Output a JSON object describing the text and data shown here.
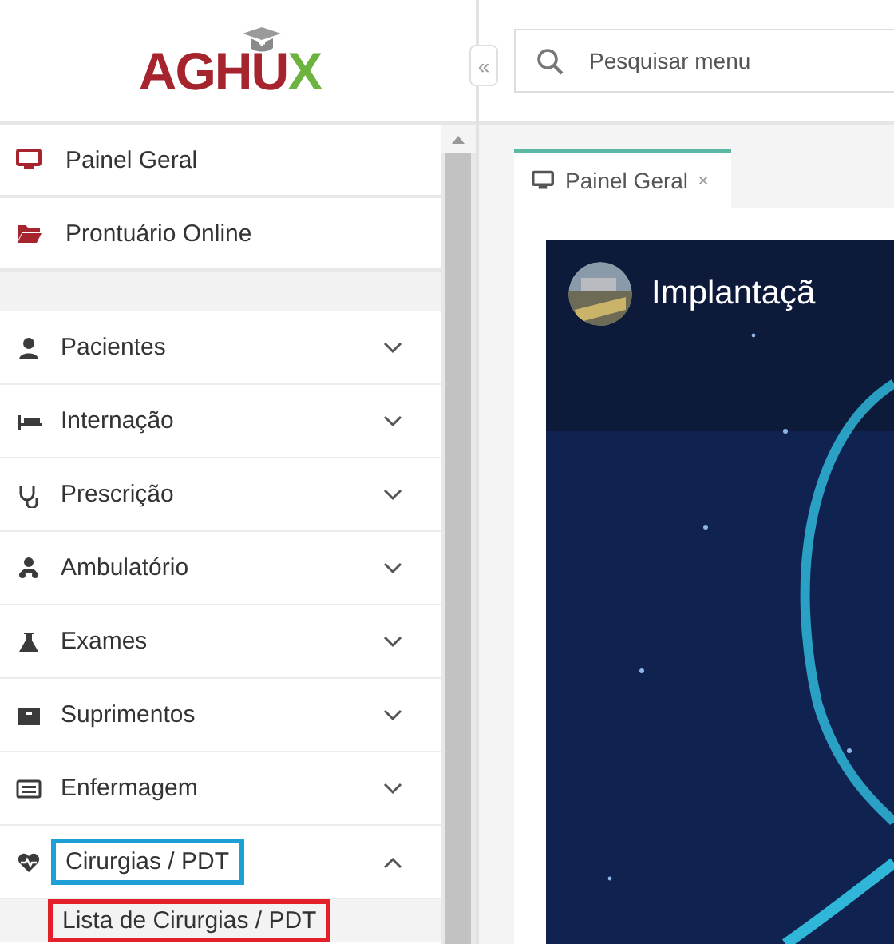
{
  "logo": {
    "text": "AGHU",
    "accent": "X"
  },
  "collapse_button": {
    "label": "«"
  },
  "search": {
    "placeholder": "Pesquisar menu"
  },
  "sidebar": {
    "items": [
      {
        "kind": "link",
        "label": "Painel Geral"
      },
      {
        "kind": "link",
        "label": "Prontuário Online"
      },
      {
        "kind": "spacer"
      },
      {
        "kind": "group",
        "label": "Pacientes",
        "expanded": false
      },
      {
        "kind": "group",
        "label": "Internação",
        "expanded": false
      },
      {
        "kind": "group",
        "label": "Prescrição",
        "expanded": false
      },
      {
        "kind": "group",
        "label": "Ambulatório",
        "expanded": false
      },
      {
        "kind": "group",
        "label": "Exames",
        "expanded": false
      },
      {
        "kind": "group",
        "label": "Suprimentos",
        "expanded": false
      },
      {
        "kind": "group",
        "label": "Enfermagem",
        "expanded": false
      },
      {
        "kind": "group",
        "label": "Cirurgias / PDT",
        "expanded": true,
        "color": "#1e9fd6",
        "children": [
          {
            "label": "Lista de Cirurgias / PDT",
            "color": "#e3202a"
          }
        ]
      }
    ]
  },
  "tabs": [
    {
      "label": "Painel Geral",
      "close": "×",
      "selected": true
    }
  ],
  "video": {
    "title": "Implantaçã"
  }
}
